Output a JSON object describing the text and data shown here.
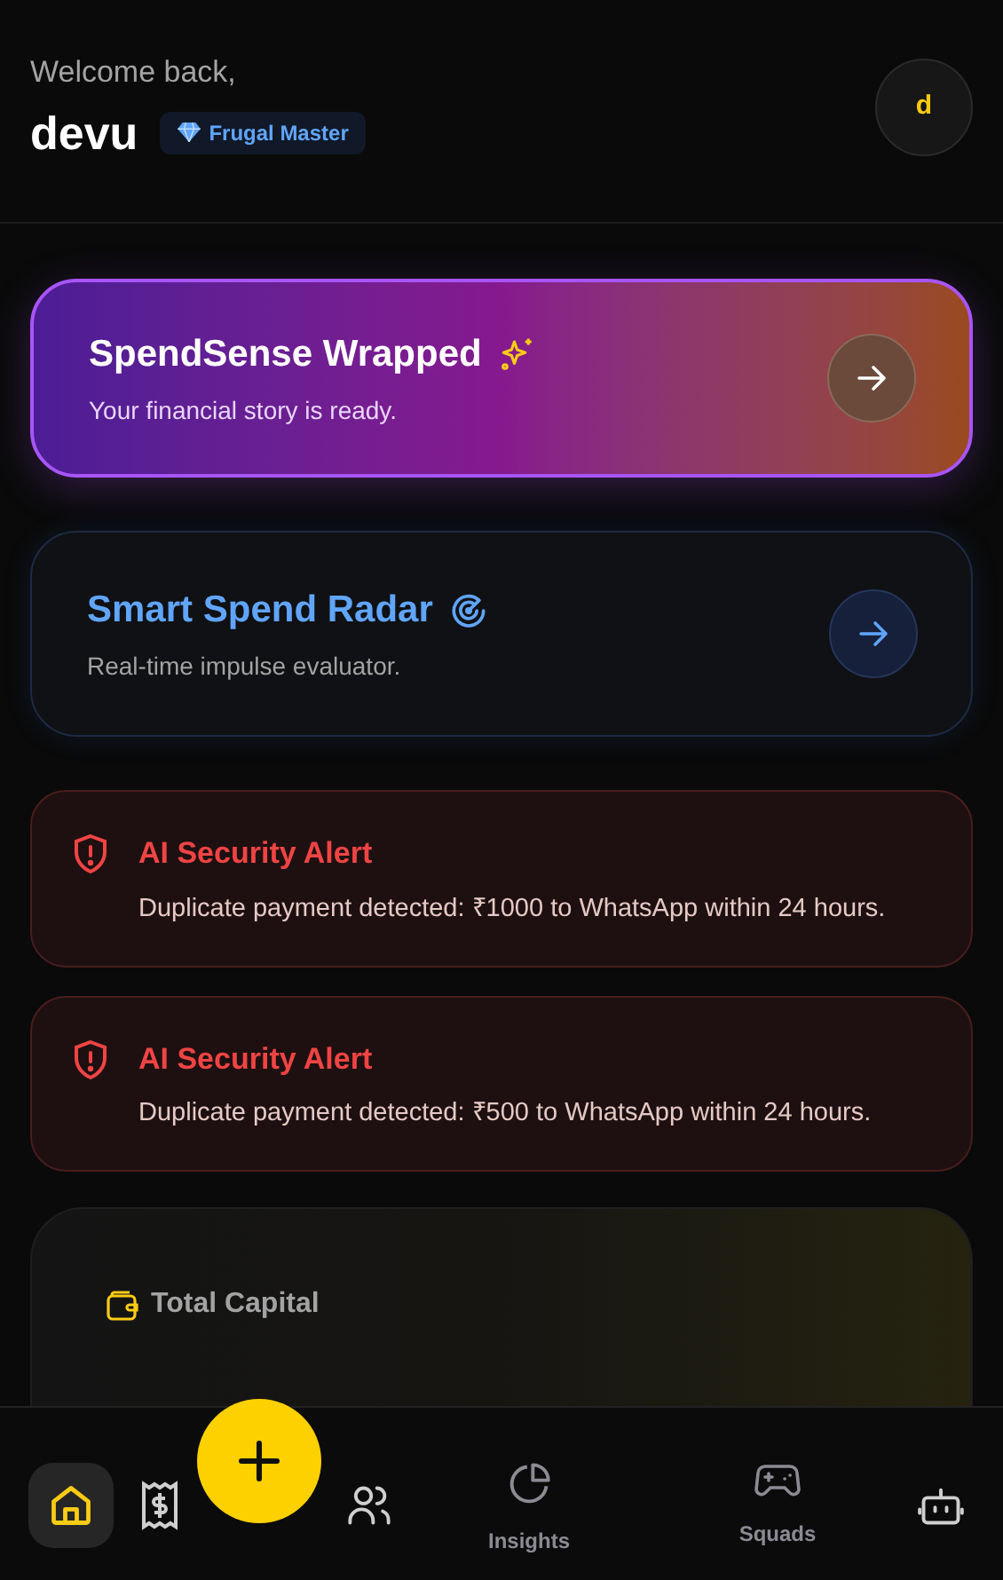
{
  "header": {
    "greeting": "Welcome back,",
    "username": "devu",
    "badge": "Frugal Master",
    "avatar_letter": "d"
  },
  "promo_cards": [
    {
      "kind": "wrapped",
      "title": "SpendSense Wrapped",
      "subtitle": "Your financial story is ready."
    },
    {
      "kind": "radar",
      "title": "Smart Spend Radar",
      "subtitle": "Real-time impulse evaluator."
    }
  ],
  "alerts": [
    {
      "title": "AI Security Alert",
      "message": "Duplicate payment detected: ₹1000 to WhatsApp within 24 hours."
    },
    {
      "title": "AI Security Alert",
      "message": "Duplicate payment detected: ₹500 to WhatsApp within 24 hours."
    }
  ],
  "capital_card": {
    "label": "Total Capital"
  },
  "nav": [
    {
      "selected": true
    },
    {
      "selected": false
    },
    {
      "selected": false
    },
    {
      "label": "Insights",
      "selected": false
    },
    {
      "label": "Squads",
      "selected": false
    },
    {
      "selected": false
    }
  ]
}
